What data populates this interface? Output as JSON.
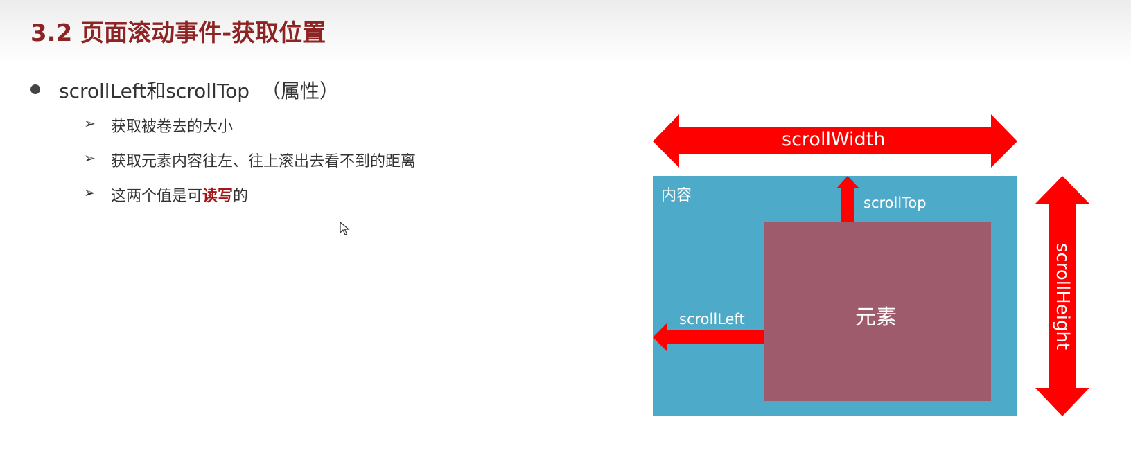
{
  "slide": {
    "title": "3.2 页面滚动事件-获取位置",
    "bullet": {
      "prefix": "scrollLeft和scrollTop",
      "suffix": "（属性）"
    },
    "subitems": [
      {
        "text": "获取被卷去的大小"
      },
      {
        "text": "获取元素内容往左、往上滚出去看不到的距离"
      },
      {
        "before": "这两个值是可",
        "highlight": "读写",
        "after": "的"
      }
    ]
  },
  "diagram": {
    "scroll_width_label": "scrollWidth",
    "scroll_height_label": "scrollHeight",
    "scroll_top_label": "scrollTop",
    "scroll_left_label": "scrollLeft",
    "content_label": "内容",
    "element_label": "元素",
    "colors": {
      "content_bg": "#4eaac9",
      "element_bg": "#9e5b6b",
      "arrow": "#ff0000",
      "title": "#8e2323"
    }
  }
}
